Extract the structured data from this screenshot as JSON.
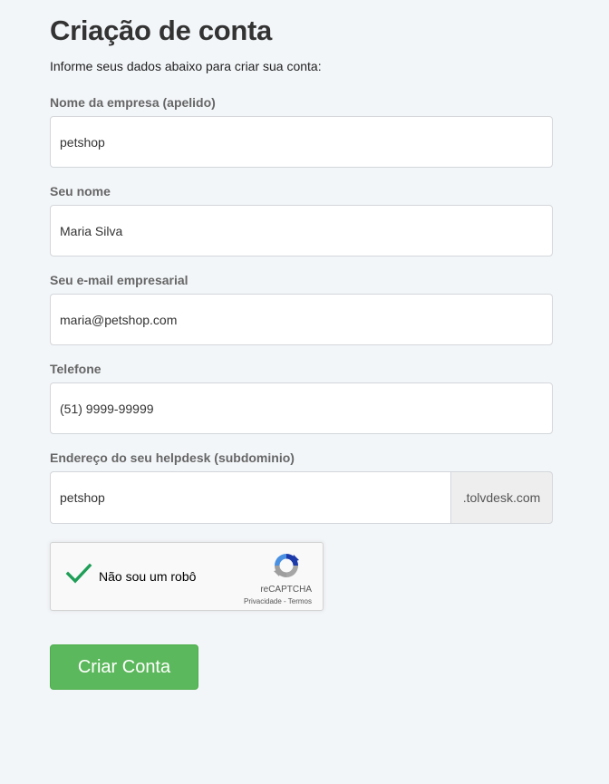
{
  "page": {
    "title": "Criação de conta",
    "subtitle": "Informe seus dados abaixo para criar sua conta:"
  },
  "form": {
    "company": {
      "label": "Nome da empresa (apelido)",
      "value": "petshop"
    },
    "name": {
      "label": "Seu nome",
      "value": "Maria Silva"
    },
    "email": {
      "label": "Seu e-mail empresarial",
      "value": "maria@petshop.com"
    },
    "phone": {
      "label": "Telefone",
      "value": "(51) 9999-99999"
    },
    "subdomain": {
      "label": "Endereço do seu helpdesk (subdominio)",
      "value": "petshop",
      "suffix": ".tolvdesk.com"
    }
  },
  "captcha": {
    "label": "Não sou um robô",
    "brand": "reCAPTCHA",
    "privacy": "Privacidade",
    "separator": " - ",
    "terms": "Termos",
    "checked": true,
    "check_icon": "checkmark-icon",
    "logo_icon": "recaptcha-logo-icon"
  },
  "submit": {
    "label": "Criar Conta"
  },
  "colors": {
    "background": "#f3f6f9",
    "primary_button": "#5cb85c",
    "check": "#1e9e57"
  }
}
